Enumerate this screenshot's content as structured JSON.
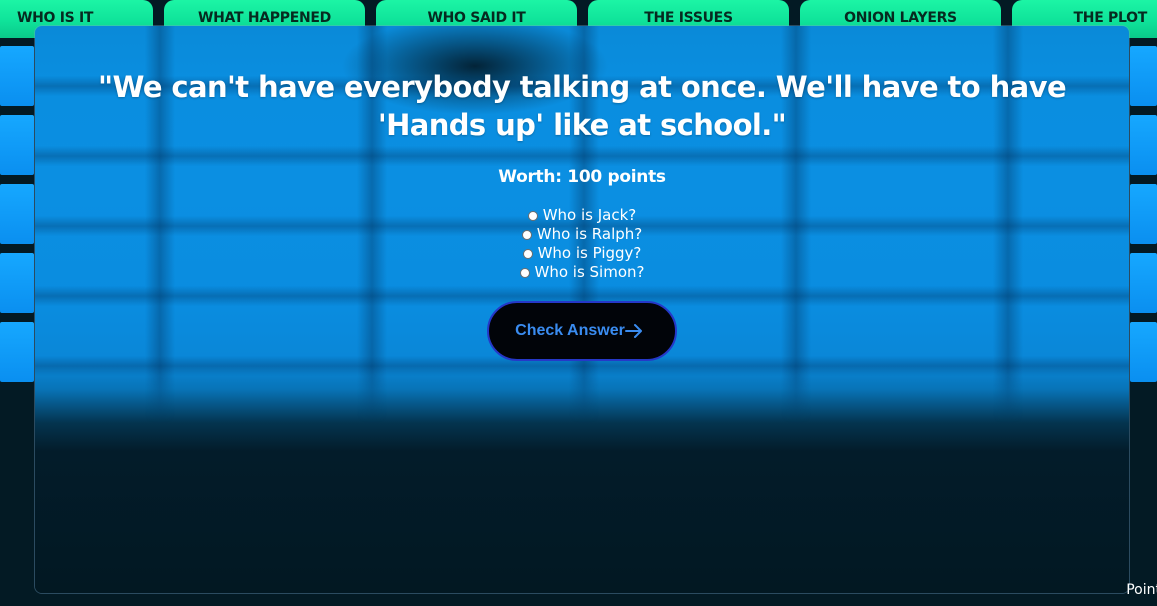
{
  "categories": [
    {
      "label": "WHO IS IT"
    },
    {
      "label": "WHAT HAPPENED"
    },
    {
      "label": "WHO SAID IT"
    },
    {
      "label": "THE ISSUES"
    },
    {
      "label": "ONION LAYERS"
    },
    {
      "label": "THE PLOT"
    }
  ],
  "modal": {
    "question": "\"We can't have everybody talking at once. We'll have to have 'Hands up' like at school.\"",
    "worth": "Worth: 100 points",
    "options": [
      {
        "label": "Who is Jack?",
        "selected": false
      },
      {
        "label": "Who is Ralph?",
        "selected": false
      },
      {
        "label": "Who is Piggy?",
        "selected": false
      },
      {
        "label": "Who is Simon?",
        "selected": false
      }
    ],
    "check_label": "Check Answer"
  },
  "footer": {
    "points_label": "Point"
  },
  "colors": {
    "category_green": "#1cf5a5",
    "tile_blue": "#0a8ff0",
    "button_text": "#3a8cf0",
    "button_border": "#2538c8",
    "background": "#021822"
  }
}
